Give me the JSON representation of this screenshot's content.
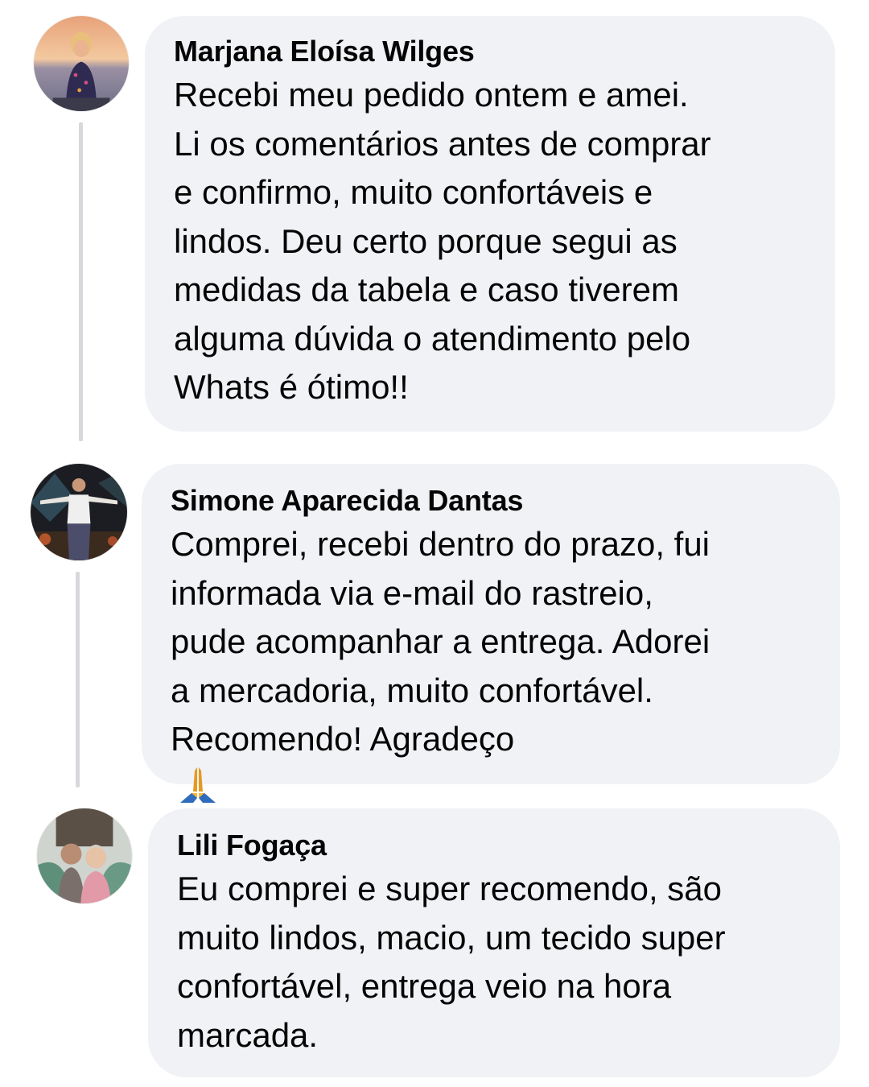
{
  "comments": [
    {
      "author": "Marjana Eloísa Wilges",
      "lines": [
        "Recebi meu pedido ontem e amei.",
        "Li os comentários antes de comprar",
        "e confirmo, muito confortáveis e",
        "lindos. Deu certo porque segui as",
        "medidas da tabela e caso tiverem",
        "alguma dúvida o atendimento pelo",
        "Whats é ótimo!!"
      ],
      "avatar_icon": "profile-photo-sunset"
    },
    {
      "author": "Simone Aparecida Dantas",
      "lines": [
        "Comprei, recebi dentro do prazo, fui",
        "informada via e-mail do rastreio,",
        "pude acompanhar a entrega.  Adorei",
        "a mercadoria, muito confortável.",
        "Recomendo! Agradeço"
      ],
      "emoji": "🙏",
      "avatar_icon": "profile-photo-night"
    },
    {
      "author": "Lili Fogaça",
      "lines": [
        "Eu comprei e super recomendo, são",
        "muito lindos, macio, um tecido super",
        "confortável, entrega veio na hora",
        "marcada."
      ],
      "avatar_icon": "profile-photo-couple"
    }
  ],
  "colors": {
    "bubble": "#f0f2f5",
    "thread_line": "#d6d8dc",
    "text": "#050505"
  }
}
